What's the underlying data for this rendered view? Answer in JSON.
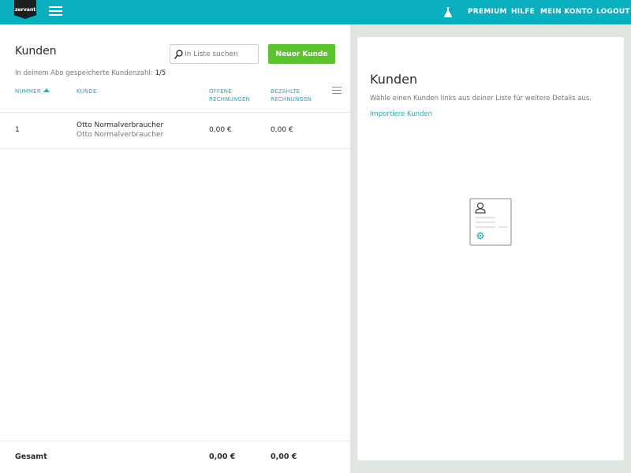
{
  "app": {
    "logo_text": "zervant"
  },
  "nav": {
    "premium": "PREMIUM",
    "help": "HILFE",
    "account": "MEIN KONTO",
    "logout": "LOGOUT"
  },
  "customers": {
    "title": "Kunden",
    "search_placeholder": "In Liste suchen",
    "new_button": "Neuer Kunde",
    "quota_label": "In deinem Abo gespeicherte Kundenzahl:",
    "quota_value": "1/5",
    "columns": {
      "number": "NUMMER",
      "customer": "KUNDE",
      "open_line1": "OFFENE",
      "open_line2": "RECHNUNGEN",
      "paid_line1": "BEZAHLTE",
      "paid_line2": "RECHNUNGEN"
    },
    "rows": [
      {
        "number": "1",
        "name": "Otto Normalverbraucher",
        "contact": "Otto Normalverbraucher",
        "open": "0,00 €",
        "paid": "0,00 €"
      }
    ],
    "footer": {
      "label": "Gesamt",
      "open_total": "0,00 €",
      "paid_total": "0,00 €"
    }
  },
  "detail": {
    "title": "Kunden",
    "description": "Wähle einen Kunden links aus deiner Liste für weitere Details aus.",
    "import_link": "Importiere Kunden"
  },
  "colors": {
    "topbar": "#0aafbf",
    "accent": "#2aa9b8",
    "primary_button": "#5cc42f",
    "background": "#dfe5df"
  },
  "icons": {
    "menu": "hamburger-icon",
    "labs": "flask-icon",
    "search": "magnifier-icon",
    "columns": "column-menu-icon",
    "empty_state": "contact-card-icon"
  }
}
